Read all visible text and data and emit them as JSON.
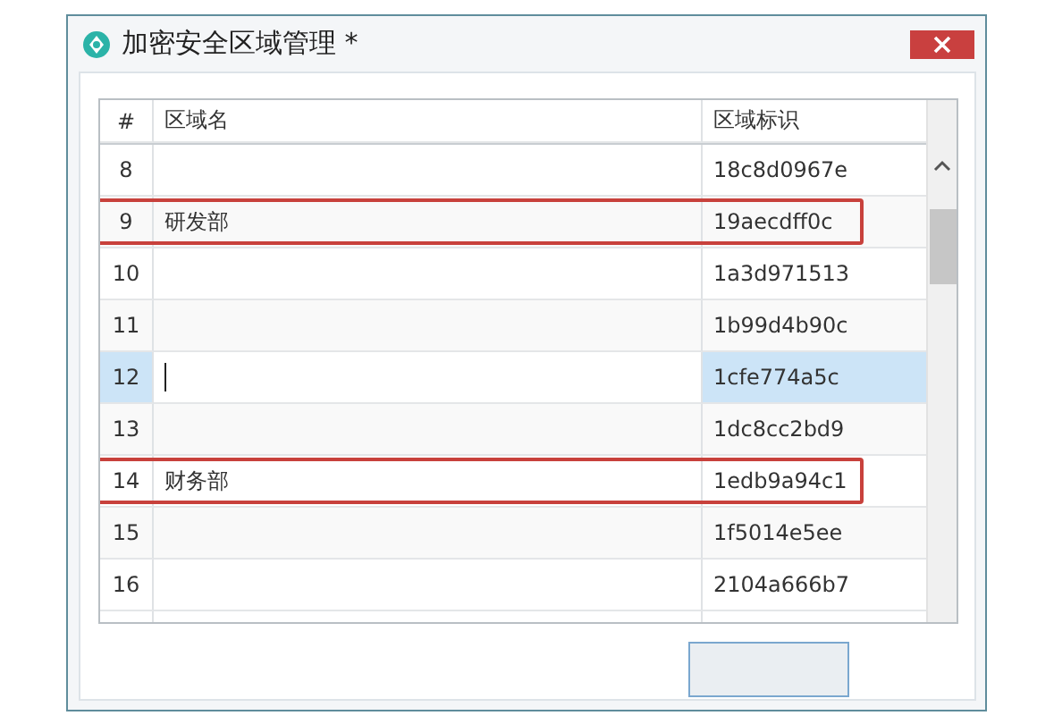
{
  "window": {
    "title": "加密安全区域管理 *"
  },
  "table": {
    "columns": [
      "#",
      "区域名",
      "区域标识"
    ],
    "rows": [
      {
        "cells": [
          "8",
          "",
          "18c8d0967e"
        ],
        "selected": false,
        "highlighted": false
      },
      {
        "cells": [
          "9",
          "研发部",
          "19aecdff0c"
        ],
        "selected": false,
        "highlighted": true
      },
      {
        "cells": [
          "10",
          "",
          "1a3d971513"
        ],
        "selected": false,
        "highlighted": false
      },
      {
        "cells": [
          "11",
          "",
          "1b99d4b90c"
        ],
        "selected": false,
        "highlighted": false
      },
      {
        "cells": [
          "12",
          "",
          "1cfe774a5c"
        ],
        "selected": true,
        "highlighted": false
      },
      {
        "cells": [
          "13",
          "",
          "1dc8cc2bd9"
        ],
        "selected": false,
        "highlighted": false
      },
      {
        "cells": [
          "14",
          "财务部",
          "1edb9a94c1"
        ],
        "selected": false,
        "highlighted": true
      },
      {
        "cells": [
          "15",
          "",
          "1f5014e5ee"
        ],
        "selected": false,
        "highlighted": false
      },
      {
        "cells": [
          "16",
          "",
          "2104a666b7"
        ],
        "selected": false,
        "highlighted": false
      }
    ]
  }
}
